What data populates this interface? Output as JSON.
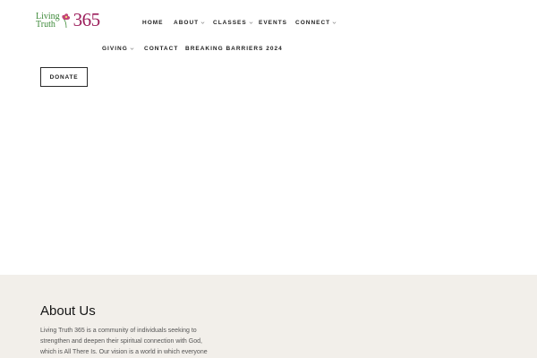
{
  "logo": {
    "line1": "Living",
    "line2": "Truth",
    "number": "365"
  },
  "nav": {
    "home": "HOME",
    "about": "ABOUT",
    "classes": "CLASSES",
    "events": "EVENTS",
    "connect": "CONNECT",
    "giving": "GIVING",
    "contact": "CONTACT",
    "breaking": "BREAKING BARRIERS 2024"
  },
  "donate": {
    "label": "DONATE"
  },
  "about": {
    "title": "About Us",
    "body": "Living Truth 365 is a community of individuals seeking to strengthen and deepen their spiritual connection with God, which is All There Is. Our vision is a world in which everyone"
  },
  "colors": {
    "logo_green": "#3e8a3a",
    "logo_magenta": "#9b1c5a",
    "about_bg": "#f2efea"
  },
  "icons": {
    "dropdown": "chevron-down-icon",
    "logo_mark": "flower-icon"
  }
}
